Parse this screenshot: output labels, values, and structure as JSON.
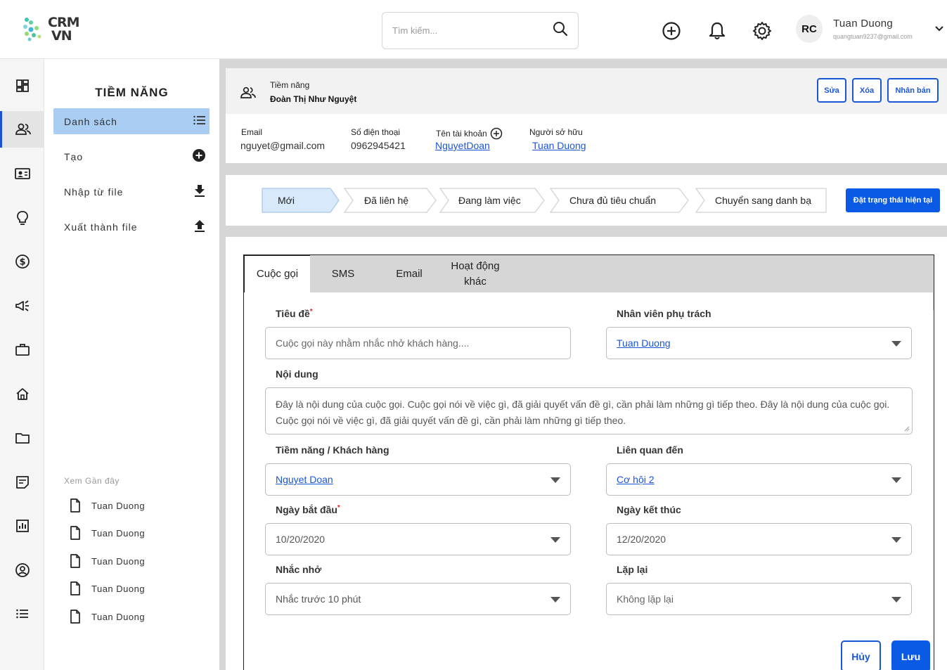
{
  "app": {
    "logo_line1": "CRM",
    "logo_line2": "VN"
  },
  "search": {
    "placeholder": "Tìm kiếm..."
  },
  "user": {
    "initials": "RC",
    "name": "Tuan Duong",
    "email": "quangtuan9237@gmail.com"
  },
  "menu": {
    "title": "TIỀM NĂNG",
    "items": [
      {
        "label": "Danh sách"
      },
      {
        "label": "Tạo"
      },
      {
        "label": "Nhập từ file"
      },
      {
        "label": "Xuất thành file"
      }
    ],
    "recent_title": "Xem Gần đây",
    "recent": [
      "Tuan Duong",
      "Tuan Duong",
      "Tuan Duong",
      "Tuan Duong",
      "Tuan Duong"
    ]
  },
  "record": {
    "type": "Tiềm năng",
    "name": "Đoàn Thị Như Nguyệt",
    "buttons": {
      "edit": "Sửa",
      "delete": "Xóa",
      "clone": "Nhân bản"
    },
    "email_label": "Email",
    "email": "nguyet@gmail.com",
    "phone_label": "Số điện thoại",
    "phone": "0962945421",
    "account_label": "Tên tài khoản",
    "account": "NguyetDoan",
    "owner_label": "Người sở hữu",
    "owner": "Tuan Duong"
  },
  "stages": {
    "items": [
      "Mới",
      "Đã liên hệ",
      "Đang làm việc",
      "Chưa đủ tiêu chuẩn",
      "Chuyển sang danh bạ"
    ],
    "active_index": 0,
    "set_button": "Đặt trạng thái hiện tại"
  },
  "tabs": [
    {
      "label": "Cuộc gọi"
    },
    {
      "label": "SMS"
    },
    {
      "label": "Email"
    },
    {
      "label": "Hoạt động khác"
    }
  ],
  "form": {
    "title_label": "Tiêu đề",
    "title_placeholder": "Cuộc gọi này nhằm nhắc nhở khách hàng....",
    "assignee_label": "Nhân viên phụ trách",
    "assignee": "Tuan Duong",
    "content_label": "Nội dung",
    "content": "Đây là nội dung của cuộc gọi. Cuộc gọi nói về việc gì, đã giải quyết vấn đề gì, cần phải làm những gì tiếp theo. Đây là nội dung của cuộc gọi. Cuộc gọi nói về việc gì, đã giải quyết vấn đề gì, cần phải làm những gì tiếp theo.",
    "lead_label": "Tiềm năng / Khách hàng",
    "lead": "Nguyet Doan",
    "related_label": "Liên quan đến",
    "related": "Cơ hội 2",
    "start_label": "Ngày bắt đầu",
    "start": "10/20/2020",
    "end_label": "Ngày kết thúc",
    "end": "12/20/2020",
    "reminder_label": "Nhắc nhở",
    "reminder": "Nhắc trước 10 phút",
    "repeat_label": "Lặp lại",
    "repeat": "Không lặp lại",
    "cancel": "Hủy",
    "save": "Lưu"
  },
  "colors": {
    "accent": "#1a56d6",
    "primary_button": "#0a5ae6",
    "active_menu": "#a9cdf3",
    "required": "#e0202a"
  }
}
